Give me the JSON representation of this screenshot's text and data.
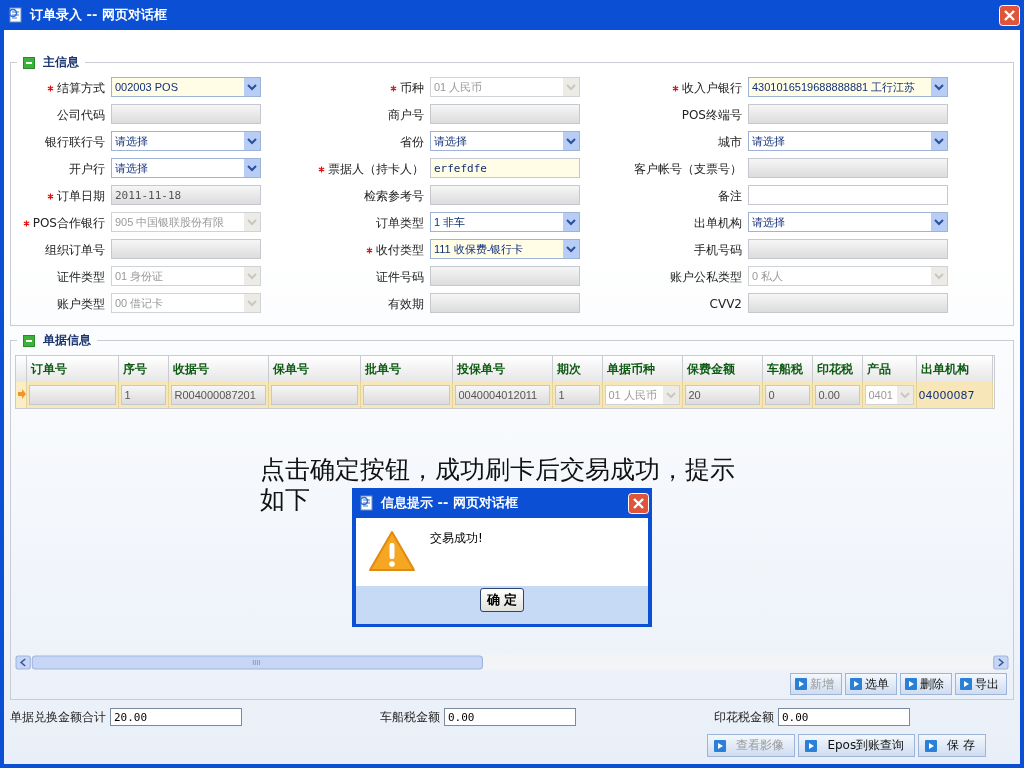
{
  "window": {
    "title": "订单录入 -- 网页对话框"
  },
  "main_info": {
    "title": "主信息",
    "fields": [
      {
        "label": "结算方式",
        "required": true,
        "kind": "select",
        "value": "002003 POS",
        "disabled": false,
        "highlighted": true
      },
      {
        "label": "币种",
        "required": true,
        "kind": "select",
        "value": "01 人民币",
        "disabled": true,
        "highlighted": false
      },
      {
        "label": "收入户银行",
        "required": true,
        "kind": "select",
        "value": "4301016519688888881 工行江苏",
        "disabled": false,
        "highlighted": true
      },
      {
        "label": "公司代码",
        "required": false,
        "kind": "text",
        "disabled": true,
        "highlighted": false
      },
      {
        "label": "商户号",
        "required": false,
        "kind": "text",
        "disabled": true,
        "highlighted": false
      },
      {
        "label": "POS终端号",
        "required": false,
        "kind": "text",
        "disabled": true,
        "highlighted": false
      },
      {
        "label": "银行联行号",
        "required": false,
        "kind": "select",
        "value": "请选择",
        "disabled": false,
        "highlighted": false
      },
      {
        "label": "省份",
        "required": false,
        "kind": "select",
        "value": "请选择",
        "disabled": false,
        "highlighted": false
      },
      {
        "label": "城市",
        "required": false,
        "kind": "select",
        "value": "请选择",
        "disabled": false,
        "highlighted": false
      },
      {
        "label": "开户行",
        "required": false,
        "kind": "select",
        "value": "请选择",
        "disabled": false,
        "highlighted": false
      },
      {
        "label": "票据人（持卡人）",
        "required": true,
        "kind": "text",
        "value": "erfefdfe",
        "disabled": false,
        "highlighted": true
      },
      {
        "label": "客户帐号（支票号）",
        "required": false,
        "kind": "text",
        "disabled": true,
        "highlighted": false
      },
      {
        "label": "订单日期",
        "required": true,
        "kind": "text",
        "value": "2011-11-18",
        "disabled": true,
        "highlighted": false
      },
      {
        "label": "检索参考号",
        "required": false,
        "kind": "text",
        "disabled": true,
        "highlighted": false
      },
      {
        "label": "备注",
        "required": false,
        "kind": "text",
        "disabled": false,
        "highlighted": false
      },
      {
        "label": "POS合作银行",
        "required": true,
        "kind": "select",
        "value": "905 中国银联股份有限",
        "disabled": true,
        "highlighted": false
      },
      {
        "label": "订单类型",
        "required": false,
        "kind": "select",
        "value": "1 非车",
        "disabled": false,
        "highlighted": false
      },
      {
        "label": "出单机构",
        "required": false,
        "kind": "select",
        "value": "请选择",
        "disabled": false,
        "highlighted": false
      },
      {
        "label": "组织订单号",
        "required": false,
        "kind": "text",
        "disabled": true,
        "highlighted": false
      },
      {
        "label": "收付类型",
        "required": true,
        "kind": "select",
        "value": "111 收保费-银行卡",
        "disabled": false,
        "highlighted": true
      },
      {
        "label": "手机号码",
        "required": false,
        "kind": "text",
        "disabled": true,
        "highlighted": false
      },
      {
        "label": "证件类型",
        "required": false,
        "kind": "select",
        "value": "01 身份证",
        "disabled": true,
        "highlighted": false
      },
      {
        "label": "证件号码",
        "required": false,
        "kind": "text",
        "disabled": true,
        "highlighted": false
      },
      {
        "label": "账户公私类型",
        "required": false,
        "kind": "select",
        "value": "0 私人",
        "disabled": true,
        "highlighted": false
      },
      {
        "label": "账户类型",
        "required": false,
        "kind": "select",
        "value": "00 借记卡",
        "disabled": true,
        "highlighted": false
      },
      {
        "label": "有效期",
        "required": false,
        "kind": "text",
        "disabled": true,
        "highlighted": false
      },
      {
        "label": "CVV2",
        "required": false,
        "kind": "text",
        "disabled": true,
        "highlighted": false
      }
    ]
  },
  "documents": {
    "title": "单据信息",
    "columns": [
      "订单号",
      "序号",
      "收据号",
      "保单号",
      "批单号",
      "投保单号",
      "期次",
      "单据币种",
      "保费金额",
      "车船税",
      "印花税",
      "产品",
      "出单机构"
    ],
    "rows": [
      {
        "selected": true,
        "cells": [
          {
            "kind": "input"
          },
          {
            "kind": "input",
            "value": "1"
          },
          {
            "kind": "input",
            "value": "R004000087201"
          },
          {
            "kind": "input"
          },
          {
            "kind": "input"
          },
          {
            "kind": "input",
            "value": "0040004012011"
          },
          {
            "kind": "input",
            "value": "1"
          },
          {
            "kind": "select",
            "value": "01 人民币"
          },
          {
            "kind": "input",
            "value": "20"
          },
          {
            "kind": "input",
            "value": "0"
          },
          {
            "kind": "input",
            "value": "0.00"
          },
          {
            "kind": "select",
            "value": "0401"
          },
          {
            "kind": "plain",
            "value": "04000087"
          }
        ]
      }
    ],
    "buttons": [
      {
        "label": "新增",
        "disabled": true
      },
      {
        "label": "选单",
        "disabled": false
      },
      {
        "label": "删除",
        "disabled": false
      },
      {
        "label": "导出",
        "disabled": false
      }
    ]
  },
  "annotation_lines": [
    "点击确定按钮，成功刷卡后交易成功，提示",
    "如下"
  ],
  "message_dialog": {
    "title": "信息提示 -- 网页对话框",
    "message": "交易成功!",
    "button": "确 定"
  },
  "totals": [
    {
      "label": "单据兑换金额合计",
      "value": "20.00"
    },
    {
      "label": "车船税金额",
      "value": "0.00"
    },
    {
      "label": "印花税金额",
      "value": "0.00"
    }
  ],
  "actions": [
    {
      "label": "查看影像",
      "disabled": true
    },
    {
      "label": "Epos到账查询",
      "disabled": false
    },
    {
      "label": "保 存",
      "disabled": false
    }
  ]
}
